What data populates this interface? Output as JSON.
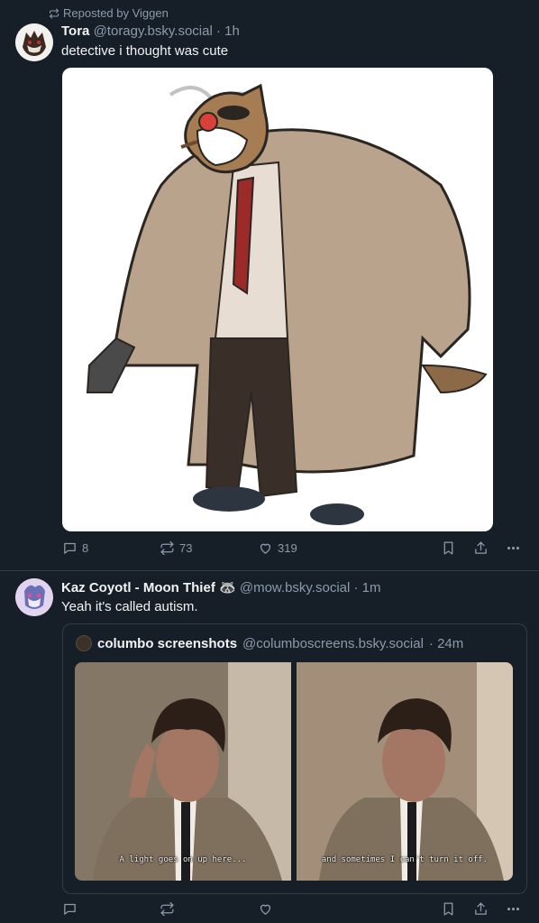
{
  "post1": {
    "repost_label": "Reposted by Viggen",
    "author_name": "Tora",
    "author_handle": "@toragy.bsky.social",
    "time": "· 1h",
    "text": "detective i thought was cute",
    "image_icon": "wolf-detective-drawing",
    "replies": "8",
    "reposts": "73",
    "likes": "319"
  },
  "post2": {
    "author_name": "Kaz Coyotl - Moon Thief 🦝",
    "author_handle": "@mow.bsky.social",
    "time": "· 1m",
    "text": "Yeah it's called autism.",
    "quote": {
      "author_name": "columbo screenshots",
      "author_handle": "@columboscreens.bsky.social",
      "time": "· 24m",
      "caption_left": "A light goes on up here...",
      "caption_right": "and sometimes I can't turn it off."
    },
    "replies": "",
    "reposts": "",
    "likes": ""
  },
  "icons": [
    "repost-icon",
    "reply-icon",
    "like-icon",
    "bookmark-icon",
    "share-icon",
    "more-icon"
  ],
  "colors": {
    "background": "#161e27",
    "muted": "#8b9bab",
    "border": "#2e3d4c"
  }
}
